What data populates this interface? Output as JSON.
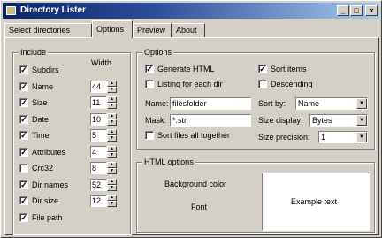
{
  "window": {
    "title": "Directory Lister",
    "min": "_",
    "max": "□",
    "close": "×"
  },
  "tabs": [
    "Select directories",
    "Options",
    "Preview",
    "About"
  ],
  "include": {
    "title": "Include",
    "width_header": "Width",
    "items": [
      {
        "label": "Subdirs",
        "checked": true
      },
      {
        "label": "Name",
        "checked": true,
        "width": "44"
      },
      {
        "label": "Size",
        "checked": true,
        "width": "11"
      },
      {
        "label": "Date",
        "checked": true,
        "width": "10"
      },
      {
        "label": "Time",
        "checked": true,
        "width": "5"
      },
      {
        "label": "Attributes",
        "checked": true,
        "width": "4"
      },
      {
        "label": "Crc32",
        "checked": false,
        "width": "8"
      },
      {
        "label": "Dir names",
        "checked": true,
        "width": "52"
      },
      {
        "label": "Dir size",
        "checked": true,
        "width": "12"
      },
      {
        "label": "File path",
        "checked": true
      }
    ]
  },
  "options": {
    "title": "Options",
    "generate_html": {
      "label": "Generate HTML",
      "checked": true
    },
    "listing_each_dir": {
      "label": "Listing for each dir",
      "checked": false
    },
    "sort_items": {
      "label": "Sort items",
      "checked": true
    },
    "descending": {
      "label": "Descending",
      "checked": false
    },
    "name_label": "Name:",
    "name_value": "filesfolder",
    "mask_label": "Mask:",
    "mask_value": "*.str",
    "sort_together": {
      "label": "Sort files all together",
      "checked": false
    },
    "sort_by_label": "Sort by:",
    "sort_by_value": "Name",
    "size_display_label": "Size display:",
    "size_display_value": "Bytes",
    "size_precision_label": "Size precision:",
    "size_precision_value": "1"
  },
  "html_options": {
    "title": "HTML options",
    "bg_color_label": "Background color",
    "font_label": "Font",
    "example_text": "Example text"
  }
}
